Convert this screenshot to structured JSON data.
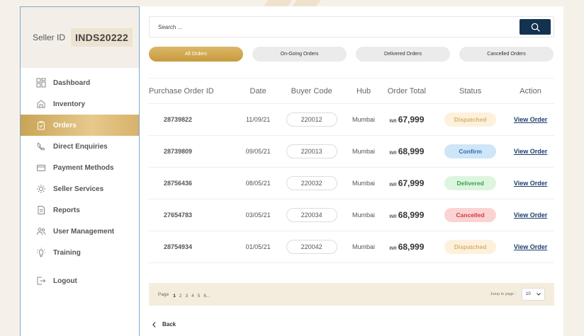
{
  "seller": {
    "label": "Seller ID",
    "id": "INDS20222"
  },
  "sidebar": {
    "items": [
      {
        "label": "Dashboard",
        "icon": "dashboard-icon",
        "active": false
      },
      {
        "label": "Inventory",
        "icon": "inventory-icon",
        "active": false
      },
      {
        "label": "Orders",
        "icon": "orders-icon",
        "active": true
      },
      {
        "label": "Direct Enquiries",
        "icon": "enquiries-icon",
        "active": false
      },
      {
        "label": "Payment Methods",
        "icon": "payment-icon",
        "active": false
      },
      {
        "label": "Seller Services",
        "icon": "services-icon",
        "active": false
      },
      {
        "label": "Reports",
        "icon": "reports-icon",
        "active": false
      },
      {
        "label": "User Management",
        "icon": "users-icon",
        "active": false
      },
      {
        "label": "Training",
        "icon": "training-icon",
        "active": false
      }
    ],
    "logout": {
      "label": "Logout",
      "icon": "logout-icon"
    }
  },
  "search": {
    "placeholder": "Search ..."
  },
  "tabs": [
    {
      "label": "All Orders",
      "active": true
    },
    {
      "label": "On-Going Orders",
      "active": false
    },
    {
      "label": "Delivered Orders",
      "active": false
    },
    {
      "label": "Cancelled Orders",
      "active": false
    }
  ],
  "table": {
    "headers": [
      "Purchase Order ID",
      "Date",
      "Buyer Code",
      "Hub",
      "Order Total",
      "Status",
      "Action"
    ],
    "rows": [
      {
        "po": "28739822",
        "date": "11/09/21",
        "buyer": "220012",
        "hub": "Mumbai",
        "currency": "INR",
        "total": "67,999",
        "status": "Dispatched",
        "status_class": "st-dispatched",
        "action": "View Order"
      },
      {
        "po": "28739809",
        "date": "09/05/21",
        "buyer": "220013",
        "hub": "Mumbai",
        "currency": "INR",
        "total": "68,999",
        "status": "Confirm",
        "status_class": "st-confirm",
        "action": "View Order"
      },
      {
        "po": "28756436",
        "date": "08/05/21",
        "buyer": "220032",
        "hub": "Mumbai",
        "currency": "INR",
        "total": "67,999",
        "status": "Delivered",
        "status_class": "st-delivered",
        "action": "View Order"
      },
      {
        "po": "27654783",
        "date": "03/05/21",
        "buyer": "220034",
        "hub": "Mumbai",
        "currency": "INR",
        "total": "68,999",
        "status": "Cancelled",
        "status_class": "st-cancelled",
        "action": "View Order"
      },
      {
        "po": "28754934",
        "date": "01/05/21",
        "buyer": "220042",
        "hub": "Mumbai",
        "currency": "INR",
        "total": "68,999",
        "status": "Dispatched",
        "status_class": "st-dispatched",
        "action": "View Order"
      }
    ]
  },
  "pagination": {
    "label": "Page",
    "pages": [
      "1",
      "2",
      "3",
      "4",
      "5",
      "6..."
    ],
    "current": "1",
    "jump_label": "Jump to page :",
    "jump_value": "10"
  },
  "back": {
    "label": "Back"
  },
  "colors": {
    "accent_gold": "#c89a3e",
    "navy": "#12324f",
    "dispatched": "#d7b172",
    "confirm": "#2f6fa8",
    "delivered": "#3aa24a",
    "cancelled": "#d23c3c"
  }
}
